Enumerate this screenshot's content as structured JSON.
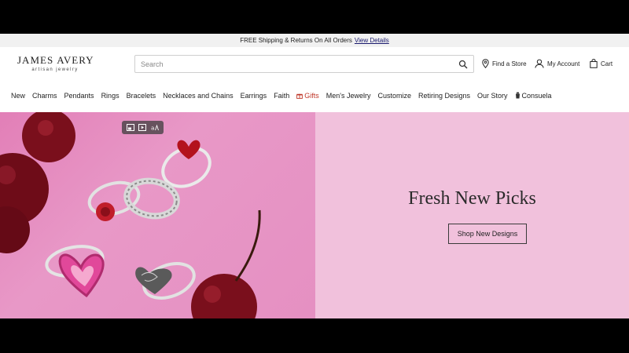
{
  "promo": {
    "text": "FREE Shipping & Returns On All Orders",
    "link": "View Details"
  },
  "logo": {
    "brand_left": "JAMES",
    "brand_right": "AVERY",
    "tagline": "artisan jewelry"
  },
  "search": {
    "placeholder": "Search",
    "icon": "search-icon"
  },
  "utility": {
    "store": {
      "label": "Find a Store",
      "icon": "location-pin-icon"
    },
    "account": {
      "label": "My Account",
      "icon": "user-icon"
    },
    "cart": {
      "label": "Cart",
      "icon": "shopping-bag-icon"
    }
  },
  "nav": [
    {
      "label": "New"
    },
    {
      "label": "Charms"
    },
    {
      "label": "Pendants"
    },
    {
      "label": "Rings"
    },
    {
      "label": "Bracelets"
    },
    {
      "label": "Necklaces and Chains"
    },
    {
      "label": "Earrings"
    },
    {
      "label": "Faith"
    },
    {
      "label": "Gifts",
      "icon": "gift-icon",
      "color": "#c0392b"
    },
    {
      "label": "Men's Jewelry"
    },
    {
      "label": "Customize"
    },
    {
      "label": "Retiring Designs"
    },
    {
      "label": "Our Story"
    },
    {
      "label": "Consuela",
      "icon": "consuela-icon"
    }
  ],
  "hero": {
    "title": "Fresh New Picks",
    "button": "Shop New Designs",
    "colors": {
      "image_bg": "#e590c2",
      "copy_bg": "#f1c1dc"
    },
    "media_controls": [
      "pip-icon",
      "play-icon",
      "accessibility-icon"
    ]
  }
}
